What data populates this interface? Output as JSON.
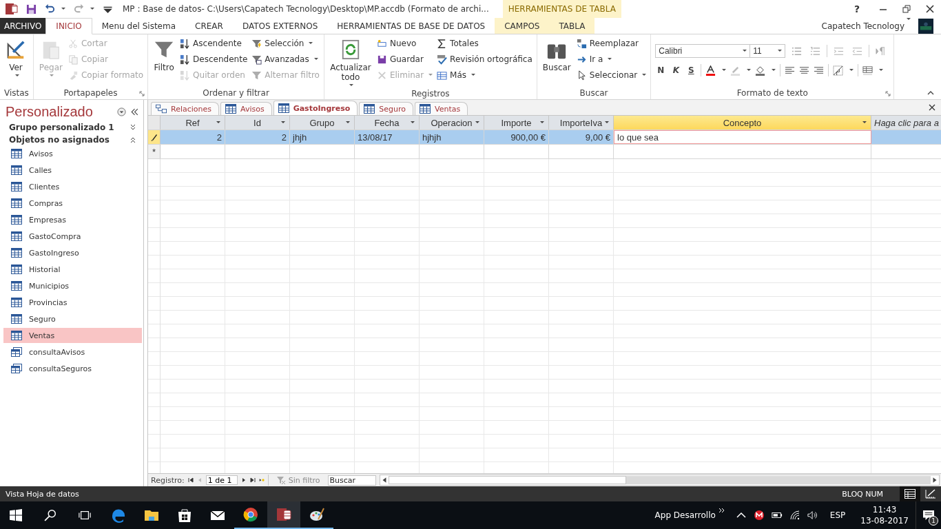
{
  "title_bar": {
    "title": "MP : Base de datos- C:\\Users\\Capatech Tecnology\\Desktop\\MP.accdb (Formato de archi...",
    "context_label": "HERRAMIENTAS DE TABLA",
    "help": "?"
  },
  "ribbon_tabs": [
    {
      "label": "ARCHIVO",
      "kind": "file",
      "selected": false
    },
    {
      "label": "INICIO",
      "kind": "normal",
      "selected": true
    },
    {
      "label": "Menu del Sistema",
      "kind": "normal",
      "selected": false
    },
    {
      "label": "CREAR",
      "kind": "normal",
      "selected": false
    },
    {
      "label": "DATOS EXTERNOS",
      "kind": "normal",
      "selected": false
    },
    {
      "label": "HERRAMIENTAS DE BASE DE DATOS",
      "kind": "normal",
      "selected": false
    },
    {
      "label": "CAMPOS",
      "kind": "context",
      "selected": false
    },
    {
      "label": "TABLA",
      "kind": "context",
      "selected": false
    }
  ],
  "account": {
    "user": "Capatech Tecnology"
  },
  "ribbon_groups": [
    {
      "label": "Vistas",
      "launcher": false,
      "large": [
        {
          "label": "Ver",
          "disabled": false,
          "dropdown": true
        }
      ]
    },
    {
      "label": "Portapapeles",
      "launcher": true,
      "large": [
        {
          "label": "Pegar",
          "disabled": true,
          "dropdown": true
        }
      ],
      "columns": [
        [
          {
            "label": "Cortar",
            "disabled": true,
            "dropdown": false
          },
          {
            "label": "Copiar",
            "disabled": true,
            "dropdown": false
          },
          {
            "label": "Copiar formato",
            "disabled": true,
            "dropdown": false
          }
        ]
      ]
    },
    {
      "label": "Ordenar y filtrar",
      "launcher": false,
      "large": [
        {
          "label": "Filtro",
          "disabled": false,
          "dropdown": false
        }
      ],
      "columns": [
        [
          {
            "label": "Ascendente",
            "disabled": false,
            "dropdown": false
          },
          {
            "label": "Descendente",
            "disabled": false,
            "dropdown": false
          },
          {
            "label": "Quitar orden",
            "disabled": true,
            "dropdown": false
          }
        ],
        [
          {
            "label": "Selección",
            "disabled": false,
            "dropdown": true
          },
          {
            "label": "Avanzadas",
            "disabled": false,
            "dropdown": true
          },
          {
            "label": "Alternar filtro",
            "disabled": true,
            "dropdown": false
          }
        ]
      ]
    },
    {
      "label": "Registros",
      "launcher": false,
      "large": [
        {
          "label": "Actualizar todo",
          "disabled": false,
          "dropdown": true
        }
      ],
      "columns": [
        [
          {
            "label": "Nuevo",
            "disabled": false,
            "dropdown": false
          },
          {
            "label": "Guardar",
            "disabled": false,
            "dropdown": false
          },
          {
            "label": "Eliminar",
            "disabled": true,
            "dropdown": true
          }
        ],
        [
          {
            "label": "Totales",
            "disabled": false,
            "dropdown": false
          },
          {
            "label": "Revisión ortográfica",
            "disabled": false,
            "dropdown": false
          },
          {
            "label": "Más",
            "disabled": false,
            "dropdown": true
          }
        ]
      ]
    },
    {
      "label": "Buscar",
      "launcher": false,
      "large": [
        {
          "label": "Buscar",
          "disabled": false,
          "dropdown": false
        }
      ],
      "columns": [
        [
          {
            "label": "Reemplazar",
            "disabled": false,
            "dropdown": false
          },
          {
            "label": "Ir a",
            "disabled": false,
            "dropdown": true
          },
          {
            "label": "Seleccionar",
            "disabled": false,
            "dropdown": true
          }
        ]
      ]
    }
  ],
  "text_format": {
    "label": "Formato de texto",
    "launcher": true,
    "font": "Calibri",
    "size": "11",
    "styles": [
      {
        "label": "N",
        "kind": "bold"
      },
      {
        "label": "K",
        "kind": "italic"
      },
      {
        "label": "S",
        "kind": "underline"
      }
    ]
  },
  "nav": {
    "title": "Personalizado",
    "groups": [
      {
        "label": "Grupo personalizado 1",
        "expanded": false
      },
      {
        "label": "Objetos no asignados",
        "expanded": true
      }
    ],
    "items": [
      {
        "label": "Avisos",
        "kind": "table",
        "selected": false
      },
      {
        "label": "Calles",
        "kind": "table",
        "selected": false
      },
      {
        "label": "Clientes",
        "kind": "table",
        "selected": false
      },
      {
        "label": "Compras",
        "kind": "table",
        "selected": false
      },
      {
        "label": "Empresas",
        "kind": "table",
        "selected": false
      },
      {
        "label": "GastoCompra",
        "kind": "table",
        "selected": false
      },
      {
        "label": "GastoIngreso",
        "kind": "table",
        "selected": false
      },
      {
        "label": "Historial",
        "kind": "table",
        "selected": false
      },
      {
        "label": "Municipios",
        "kind": "table",
        "selected": false
      },
      {
        "label": "Provincias",
        "kind": "table",
        "selected": false
      },
      {
        "label": "Seguro",
        "kind": "table",
        "selected": false
      },
      {
        "label": "Ventas",
        "kind": "table",
        "selected": true
      },
      {
        "label": "consultaAvisos",
        "kind": "query",
        "selected": false
      },
      {
        "label": "consultaSeguros",
        "kind": "query",
        "selected": false
      }
    ]
  },
  "doc_tabs": [
    {
      "label": "Relaciones",
      "kind": "relationships",
      "selected": false
    },
    {
      "label": "Avisos",
      "kind": "table",
      "selected": false
    },
    {
      "label": "GastoIngreso",
      "kind": "table",
      "selected": true
    },
    {
      "label": "Seguro",
      "kind": "table",
      "selected": false
    },
    {
      "label": "Ventas",
      "kind": "table",
      "selected": false
    }
  ],
  "datasheet": {
    "columns": [
      {
        "label": "Ref",
        "kind": "number",
        "selected": false
      },
      {
        "label": "Id",
        "kind": "number",
        "selected": false
      },
      {
        "label": "Grupo",
        "kind": "text",
        "selected": false
      },
      {
        "label": "Fecha",
        "kind": "text",
        "selected": false
      },
      {
        "label": "Operacion",
        "kind": "text",
        "selected": false
      },
      {
        "label": "Importe",
        "kind": "number",
        "selected": false
      },
      {
        "label": "ImporteIva",
        "kind": "number",
        "selected": false
      },
      {
        "label": "Concepto",
        "kind": "text",
        "selected": true
      },
      {
        "label": "Haga clic para a",
        "kind": "add",
        "selected": false
      }
    ],
    "rows": [
      {
        "editing": true,
        "selected": true,
        "cells": [
          "2",
          "2",
          "jhjh",
          "13/08/17",
          "hjhjh",
          "900,00 €",
          "9,00 €",
          "lo que sea"
        ]
      }
    ],
    "new_row_marker": "*"
  },
  "record_nav": {
    "label": "Registro:",
    "position": "1 de 1",
    "filter": "Sin filtro",
    "search_placeholder": "Buscar"
  },
  "status_bar": {
    "text": "Vista Hoja de datos",
    "indicator": "BLOQ NUM",
    "views": [
      {
        "kind": "datasheet",
        "selected": true
      },
      {
        "kind": "design",
        "selected": false
      }
    ]
  },
  "taskbar": {
    "apps": [
      {
        "kind": "edge",
        "running": false,
        "active": false
      },
      {
        "kind": "folder",
        "running": false,
        "active": false
      },
      {
        "kind": "store",
        "running": false,
        "active": false
      },
      {
        "kind": "mail",
        "running": false,
        "active": false
      },
      {
        "kind": "chrome",
        "running": true,
        "active": false
      },
      {
        "kind": "access",
        "running": true,
        "active": true
      },
      {
        "kind": "paint",
        "running": true,
        "active": false
      }
    ],
    "toolbar_label": "App Desarrollo",
    "language": "ESP",
    "time": "11:43",
    "date": "13-08-2017",
    "notifications": "1"
  }
}
